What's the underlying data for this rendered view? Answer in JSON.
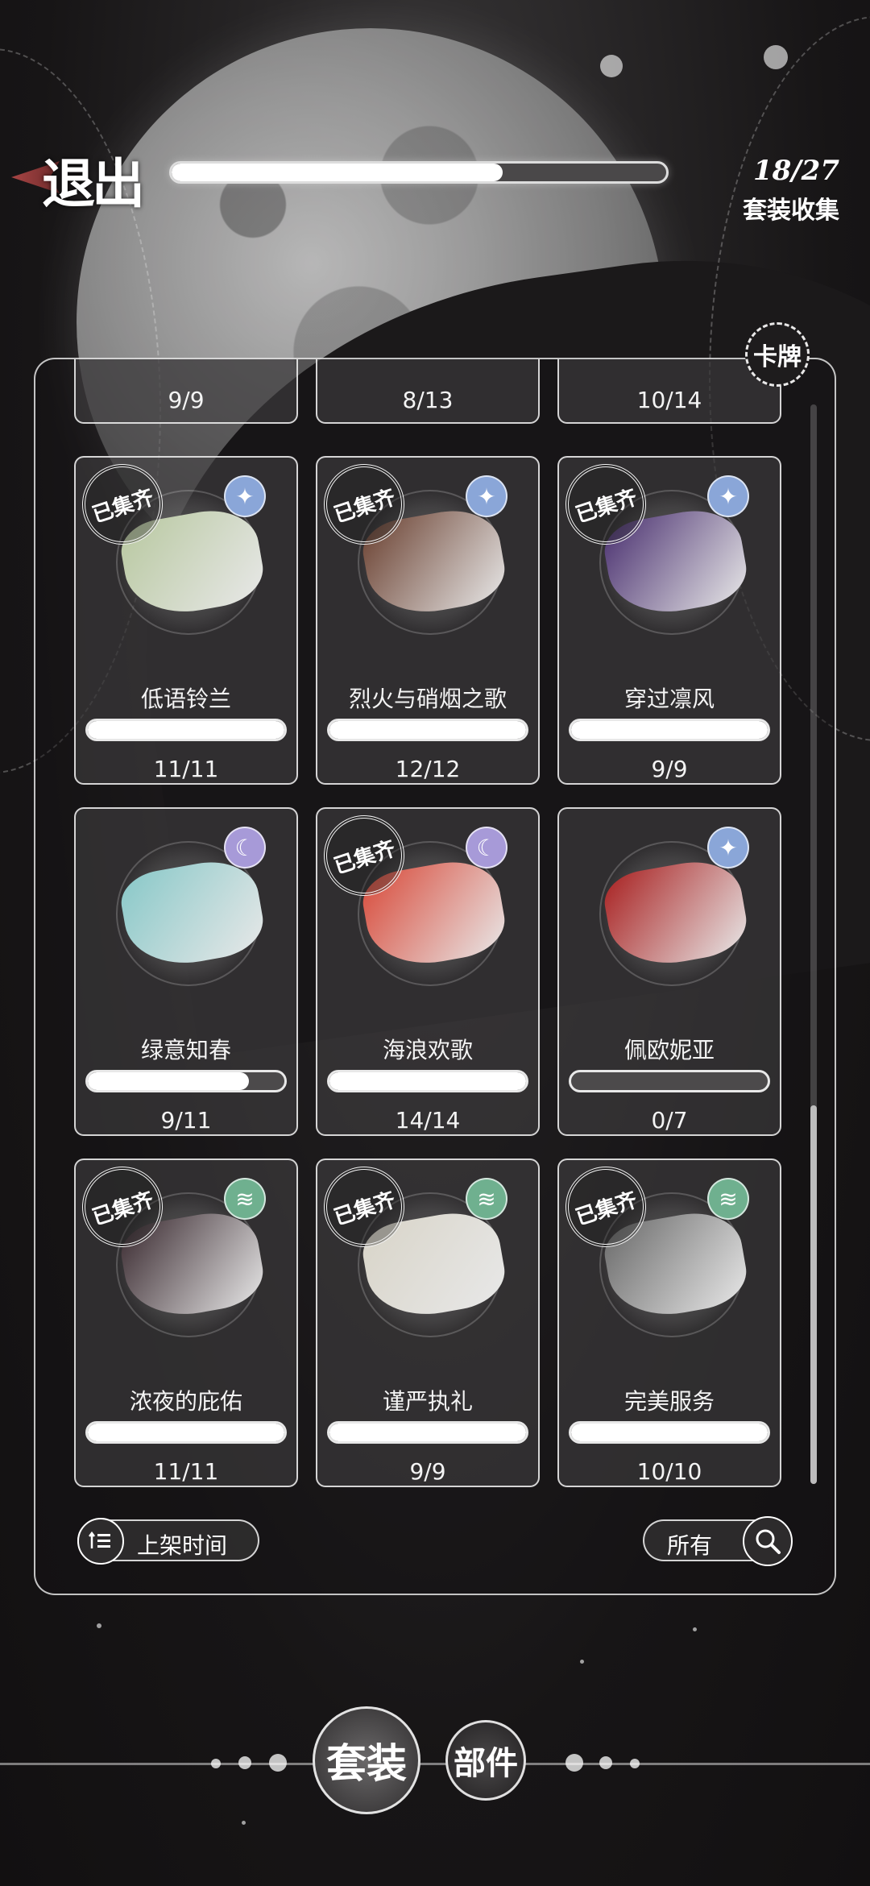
{
  "header": {
    "exit_label": "退出",
    "progress_fraction": 0.67,
    "collect_count": "18/27",
    "collect_label": "套装收集"
  },
  "card_deck_label": "卡牌",
  "stamp_text": "已集齐",
  "partial_row": [
    {
      "count": "9/9"
    },
    {
      "count": "8/13"
    },
    {
      "count": "10/14"
    }
  ],
  "cards": [
    {
      "name": "低语铃兰",
      "count": "11/11",
      "collected": true,
      "progress": 1.0,
      "badge_icon": "sparkle-icon",
      "badge_color": "#8aa6d8",
      "outfit_color": "#b8c8a0"
    },
    {
      "name": "烈火与硝烟之歌",
      "count": "12/12",
      "collected": true,
      "progress": 1.0,
      "badge_icon": "sparkle-icon",
      "badge_color": "#8aa6d8",
      "outfit_color": "#6a4030"
    },
    {
      "name": "穿过凛风",
      "count": "9/9",
      "collected": true,
      "progress": 1.0,
      "badge_icon": "sparkle-icon",
      "badge_color": "#8aa6d8",
      "outfit_color": "#4a3070"
    },
    {
      "name": "绿意知春",
      "count": "9/11",
      "collected": false,
      "progress": 0.82,
      "badge_icon": "moon-icon",
      "badge_color": "#a79ad8",
      "outfit_color": "#88c8c8"
    },
    {
      "name": "海浪欢歌",
      "count": "14/14",
      "collected": true,
      "progress": 1.0,
      "badge_icon": "moon-icon",
      "badge_color": "#a79ad8",
      "outfit_color": "#d84a3a"
    },
    {
      "name": "佩欧妮亚",
      "count": "0/7",
      "collected": false,
      "progress": 0.0,
      "badge_icon": "sparkle-icon",
      "badge_color": "#8aa6d8",
      "outfit_color": "#a82020"
    },
    {
      "name": "浓夜的庇佑",
      "count": "11/11",
      "collected": true,
      "progress": 1.0,
      "badge_icon": "wave-icon",
      "badge_color": "#6fb08f",
      "outfit_color": "#3a2a30"
    },
    {
      "name": "谨严执礼",
      "count": "9/9",
      "collected": true,
      "progress": 1.0,
      "badge_icon": "wave-icon",
      "badge_color": "#6fb08f",
      "outfit_color": "#d8d4c8"
    },
    {
      "name": "完美服务",
      "count": "10/10",
      "collected": true,
      "progress": 1.0,
      "badge_icon": "wave-icon",
      "badge_color": "#6fb08f",
      "outfit_color": "#6a6a6a"
    }
  ],
  "sort": {
    "label": "上架时间",
    "icon": "sort-list-icon"
  },
  "filter": {
    "label": "所有",
    "icon": "search-icon"
  },
  "bottom_nav": {
    "suit_label": "套装",
    "part_label": "部件"
  }
}
